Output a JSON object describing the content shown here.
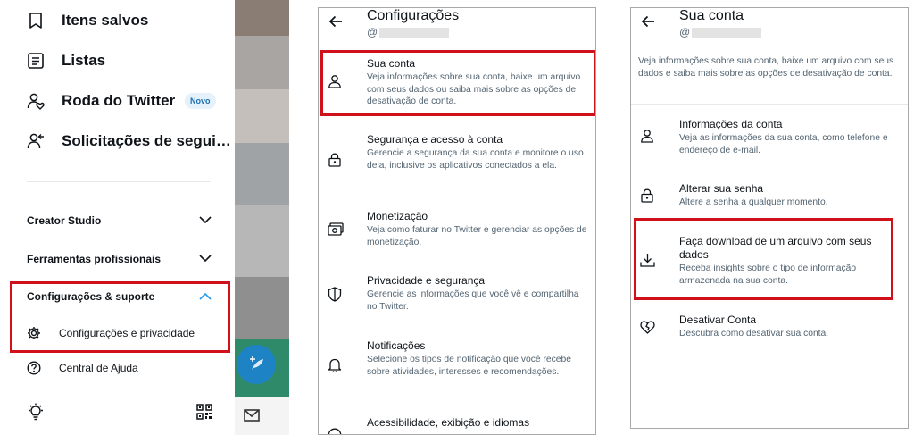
{
  "drawer": {
    "items": [
      {
        "label": "Itens salvos",
        "icon": "bookmark-icon"
      },
      {
        "label": "Listas",
        "icon": "list-icon"
      },
      {
        "label": "Roda do Twitter",
        "icon": "people-heart-icon",
        "badge": "Novo"
      },
      {
        "label": "Solicitações de segui…",
        "icon": "follow-request-icon"
      }
    ],
    "sections": [
      {
        "label": "Creator Studio",
        "expanded": false
      },
      {
        "label": "Ferramentas profissionais",
        "expanded": false
      },
      {
        "label": "Configurações & suporte",
        "expanded": true
      }
    ],
    "subitems": [
      {
        "label": "Configurações e privacidade",
        "icon": "gear-icon"
      },
      {
        "label": "Central de Ajuda",
        "icon": "help-circle-icon"
      }
    ],
    "footer_icons": [
      "lightbulb-icon",
      "qr-code-icon"
    ],
    "accent": "#1d9bf0",
    "highlight": "#d0111b"
  },
  "settings": {
    "title": "Configurações",
    "handle": "@",
    "rows": [
      {
        "title": "Sua conta",
        "desc": "Veja informações sobre sua conta, baixe um arquivo com seus dados ou saiba mais sobre as opções de desativação de conta.",
        "icon": "person-icon"
      },
      {
        "title": "Segurança e acesso à conta",
        "desc": "Gerencie a segurança da sua conta e monitore o uso dela, inclusive os aplicativos conectados a ela.",
        "icon": "lock-icon"
      },
      {
        "title": "Monetização",
        "desc": "Veja como faturar no Twitter e gerenciar as opções de monetização.",
        "icon": "money-icon"
      },
      {
        "title": "Privacidade e segurança",
        "desc": "Gerencie as informações que você vê e compartilha no Twitter.",
        "icon": "shield-icon"
      },
      {
        "title": "Notificações",
        "desc": "Selecione os tipos de notificação que você recebe sobre atividades, interesses e recomendações.",
        "icon": "bell-icon"
      },
      {
        "title": "Acessibilidade, exibição e idiomas",
        "desc": "",
        "icon": "accessibility-icon"
      }
    ]
  },
  "account": {
    "title": "Sua conta",
    "handle": "@",
    "intro": "Veja informações sobre sua conta, baixe um arquivo com seus dados e saiba mais sobre as opções de desativação de conta.",
    "rows": [
      {
        "title": "Informações da conta",
        "desc": "Veja as informações da sua conta, como telefone e endereço de e-mail.",
        "icon": "person-icon"
      },
      {
        "title": "Alterar sua senha",
        "desc": "Altere a senha a qualquer momento.",
        "icon": "lock-icon"
      },
      {
        "title": "Faça download de um arquivo com seus dados",
        "desc": "Receba insights sobre o tipo de informação armazenada na sua conta.",
        "icon": "download-icon"
      },
      {
        "title": "Desativar Conta",
        "desc": "Descubra como desativar sua conta.",
        "icon": "broken-heart-icon"
      }
    ]
  }
}
